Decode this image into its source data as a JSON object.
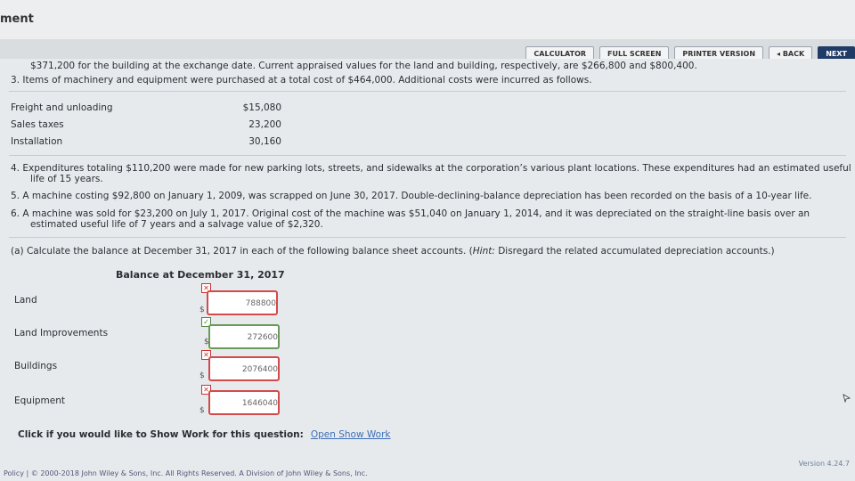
{
  "header": {
    "title": "ment"
  },
  "toolbar": {
    "calculator": "CALCULATOR",
    "fullscreen": "FULL SCREEN",
    "printer": "PRINTER VERSION",
    "back": "◂ BACK",
    "next": "NEXT"
  },
  "problem": {
    "line0": "$371,200 for the building at the exchange date. Current appraised values for the land and building, respectively, are $266,800 and $800,400.",
    "item3": "3.  Items of machinery and equipment were purchased at a total cost of $464,000. Additional costs were incurred as follows.",
    "costs": [
      {
        "label": "Freight and unloading",
        "value": "$15,080"
      },
      {
        "label": "Sales taxes",
        "value": "23,200"
      },
      {
        "label": "Installation",
        "value": "30,160"
      }
    ],
    "item4a": "4.  Expenditures totaling $110,200 were made for new parking lots, streets, and sidewalks at the corporation’s various plant locations. These expenditures had an estimated useful",
    "item4b": "life of 15 years.",
    "item5": "5.  A machine costing $92,800 on January 1, 2009, was scrapped on June 30, 2017. Double-declining-balance depreciation has been recorded on the basis of a 10-year life.",
    "item6a": "6.  A machine was sold for $23,200 on July 1, 2017. Original cost of the machine was $51,040 on January 1, 2014, and it was depreciated on the straight-line basis over an",
    "item6b": "estimated useful life of 7 years and a salvage value of $2,320."
  },
  "question": {
    "prefix": "(a) Calculate the balance at December 31, 2017 in each of the following balance sheet accounts. (",
    "hint": "Hint:",
    "suffix": " Disregard the related accumulated depreciation accounts.)"
  },
  "balance": {
    "heading": "Balance at December 31, 2017",
    "currency": "$",
    "rows": [
      {
        "label": "Land",
        "value": "788800",
        "status": "incorrect"
      },
      {
        "label": "Land Improvements",
        "value": "272600",
        "status": "correct"
      },
      {
        "label": "Buildings",
        "value": "2076400",
        "status": "incorrect"
      },
      {
        "label": "Equipment",
        "value": "1646040",
        "status": "incorrect"
      }
    ]
  },
  "showwork": {
    "text": "Click if you would like to Show Work for this question:",
    "link": "Open Show Work"
  },
  "footer": {
    "text": "Policy  |  © 2000-2018 John Wiley & Sons, Inc. All Rights Reserved. A Division of John Wiley & Sons, Inc.",
    "version": "Version 4.24.7"
  },
  "colors": {
    "incorrect": "#d24a4a",
    "correct": "#6a9a5a",
    "link": "#3e6fb7",
    "next_button": "#1f3b66"
  }
}
